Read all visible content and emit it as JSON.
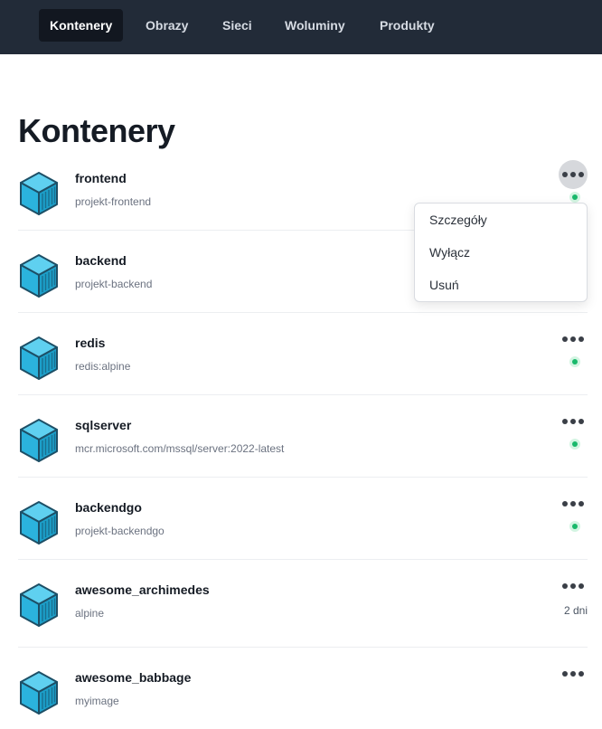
{
  "nav": {
    "items": [
      {
        "label": "Kontenery",
        "active": true
      },
      {
        "label": "Obrazy",
        "active": false
      },
      {
        "label": "Sieci",
        "active": false
      },
      {
        "label": "Woluminy",
        "active": false
      },
      {
        "label": "Produkty",
        "active": false
      }
    ]
  },
  "page": {
    "title": "Kontenery"
  },
  "containers": [
    {
      "name": "frontend",
      "image": "projekt-frontend",
      "status": "running",
      "actions_icon": "more-dots-icon"
    },
    {
      "name": "backend",
      "image": "projekt-backend",
      "status": "running",
      "actions_icon": "more-dots-icon"
    },
    {
      "name": "redis",
      "image": "redis:alpine",
      "status": "running",
      "actions_icon": "more-dots-icon"
    },
    {
      "name": "sqlserver",
      "image": "mcr.microsoft.com/mssql/server:2022-latest",
      "status": "running",
      "actions_icon": "more-dots-icon"
    },
    {
      "name": "backendgo",
      "image": "projekt-backendgo",
      "status": "running",
      "actions_icon": "more-dots-icon"
    },
    {
      "name": "awesome_archimedes",
      "image": "alpine",
      "status": "stopped",
      "age": "2 dni",
      "actions_icon": "more-dots-icon"
    },
    {
      "name": "awesome_babbage",
      "image": "myimage",
      "status": "stopped",
      "actions_icon": "more-dots-icon"
    }
  ],
  "context_menu": {
    "open_for": "frontend",
    "items": [
      {
        "label": "Szczegóły"
      },
      {
        "label": "Wyłącz"
      },
      {
        "label": "Usuń"
      }
    ]
  },
  "colors": {
    "nav_bg": "#222b38",
    "nav_active_bg": "#121720",
    "status_running": "#19b96b",
    "container_icon": "#2fb8e0"
  }
}
